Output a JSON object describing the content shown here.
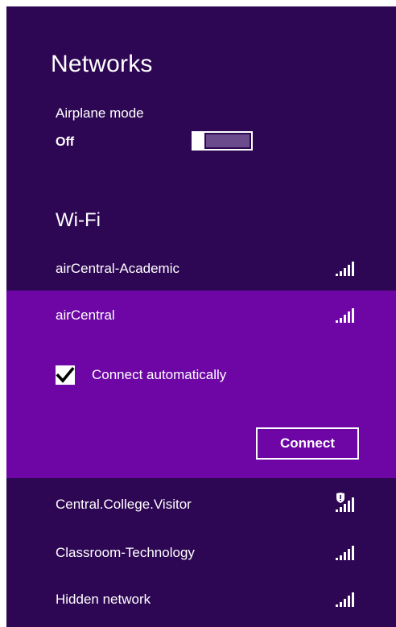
{
  "header": {
    "title": "Networks"
  },
  "airplane_mode": {
    "label": "Airplane mode",
    "state": "Off",
    "on": false
  },
  "wifi": {
    "section_title": "Wi-Fi",
    "networks": [
      {
        "name": "airCentral-Academic",
        "secured": true,
        "signal_bars": 5
      },
      {
        "name": "airCentral",
        "secured": true,
        "signal_bars": 5,
        "selected": true,
        "connect_automatically_label": "Connect automatically",
        "connect_automatically_checked": true,
        "connect_button_label": "Connect"
      },
      {
        "name": "Central.College.Visitor",
        "secured": false,
        "signal_bars": 5,
        "shield_icon": true
      },
      {
        "name": "Classroom-Technology",
        "secured": true,
        "signal_bars": 5
      },
      {
        "name": "Hidden network",
        "secured": true,
        "signal_bars": 5
      }
    ]
  },
  "colors": {
    "panel_background": "#2e0754",
    "selected_background": "#6d06a5",
    "toggle_off_track": "#6c4b8c",
    "text": "#ffffff"
  }
}
